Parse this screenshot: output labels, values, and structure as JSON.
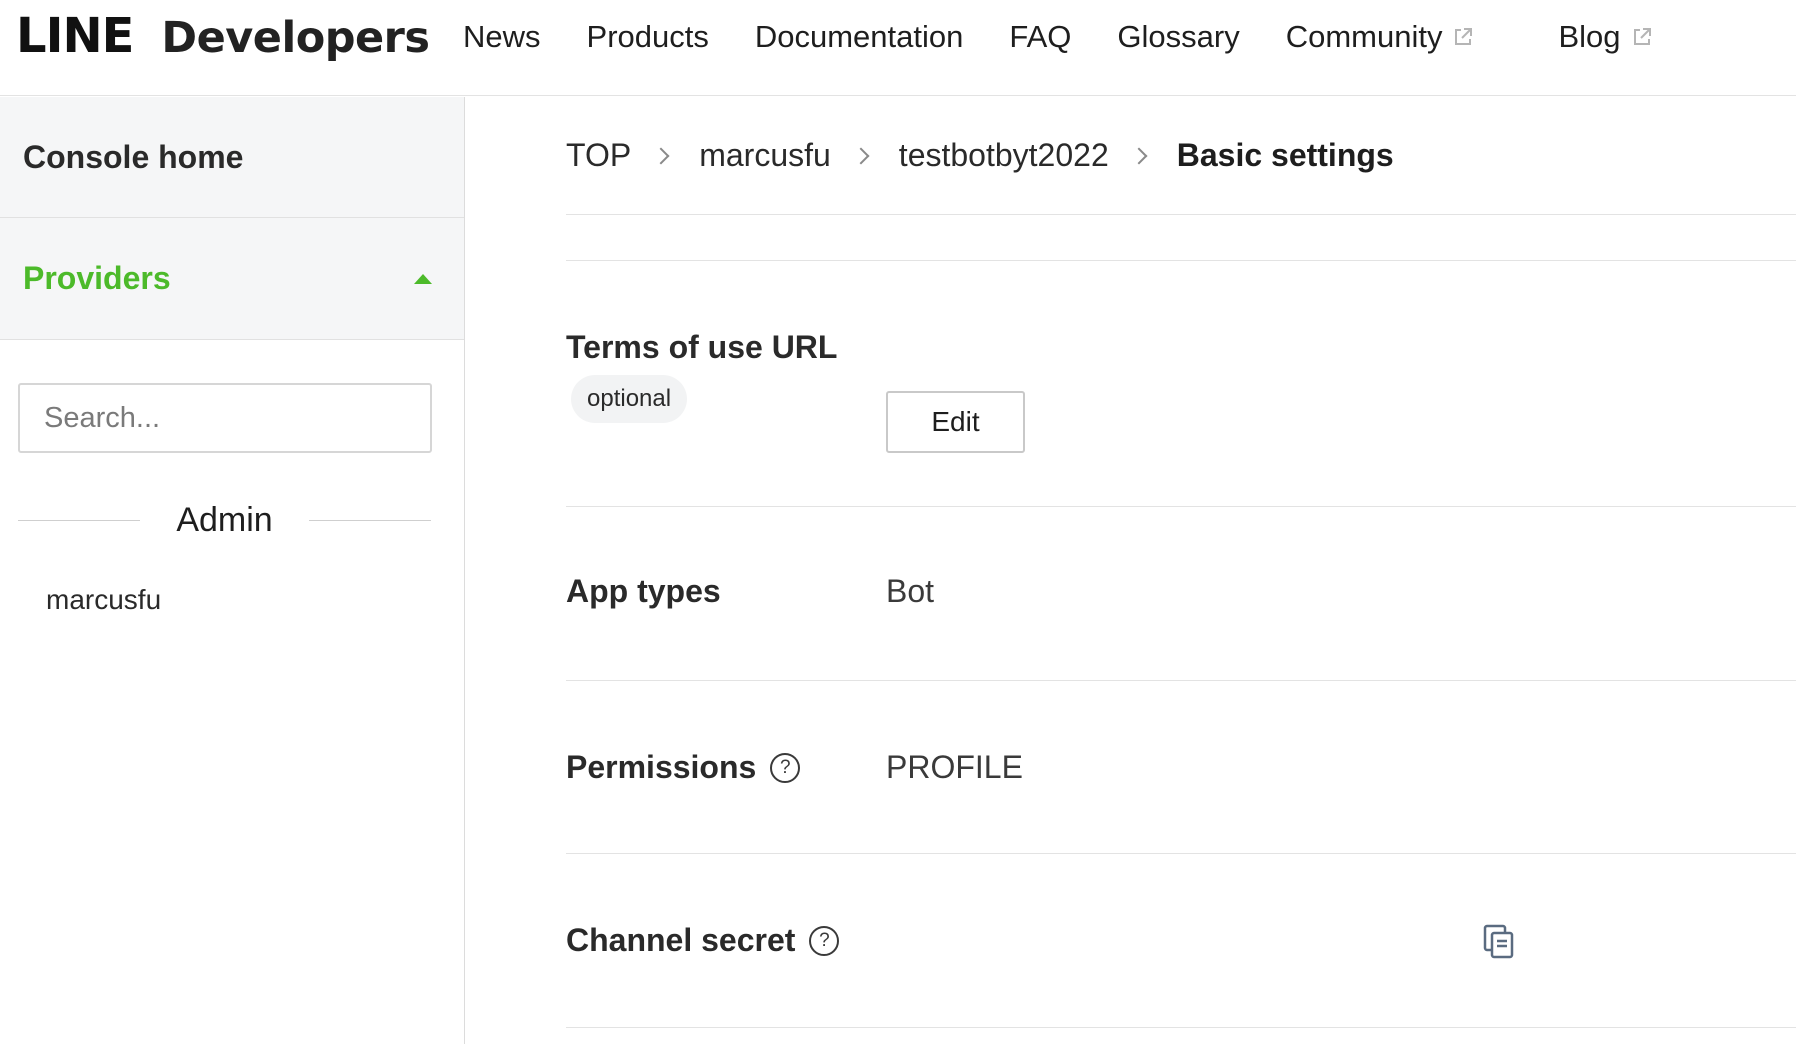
{
  "header": {
    "logo_main": "LINE",
    "logo_sub": "Developers",
    "nav": [
      {
        "label": "News",
        "external": false
      },
      {
        "label": "Products",
        "external": false
      },
      {
        "label": "Documentation",
        "external": false
      },
      {
        "label": "FAQ",
        "external": false
      },
      {
        "label": "Glossary",
        "external": false
      },
      {
        "label": "Community",
        "external": true
      },
      {
        "label": "Blog",
        "external": true
      }
    ]
  },
  "sidebar": {
    "console_home": "Console home",
    "providers_label": "Providers",
    "search_placeholder": "Search...",
    "admin_label": "Admin",
    "providers": [
      "marcusfu"
    ]
  },
  "breadcrumb": [
    "TOP",
    "marcusfu",
    "testbotbyt2022",
    "Basic settings"
  ],
  "settings": {
    "terms_label": "Terms of use URL",
    "terms_badge": "optional",
    "terms_button": "Edit",
    "app_types_label": "App types",
    "app_types_value": "Bot",
    "permissions_label": "Permissions",
    "permissions_value": "PROFILE",
    "channel_secret_label": "Channel secret"
  },
  "colors": {
    "accent_green": "#4cba2a",
    "sidebar_bg": "#f5f6f7"
  },
  "icons": [
    "external-link-icon",
    "caret-up-icon",
    "chevron-right-icon",
    "help-icon",
    "copy-icon"
  ]
}
